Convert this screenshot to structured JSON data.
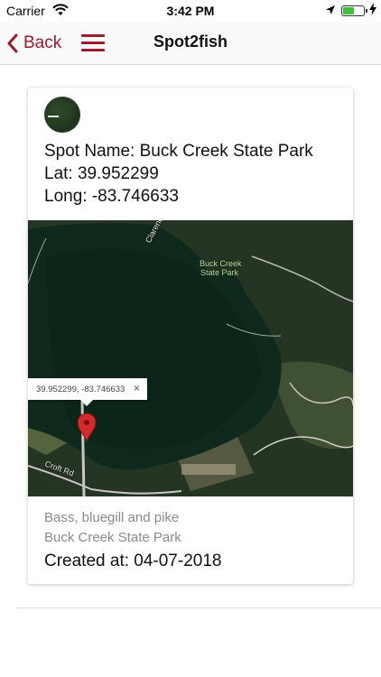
{
  "status_bar": {
    "carrier": "Carrier",
    "time": "3:42 PM",
    "icons": [
      "wifi-icon",
      "location-arrow-icon",
      "battery-icon",
      "charging-bolt-icon"
    ]
  },
  "nav": {
    "back_label": "Back",
    "title": "Spot2fish",
    "accent_color": "#9b1b2e"
  },
  "spot": {
    "name_line": "Spot Name: Buck Creek State Park",
    "lat_line": "Lat: 39.952299",
    "long_line": "Long: -83.746633",
    "fish": "Bass, bluegill and pike",
    "location": "Buck Creek State Park",
    "created_line": "Created at: 04-07-2018"
  },
  "map": {
    "callout_coords": "39.952299, -83.746633",
    "close_glyph": "×",
    "park_label_1": "Buck Creek",
    "park_label_2": "State Park",
    "road_label_1": "Clarence J Brown",
    "road_label_2": "Croft Rd"
  }
}
